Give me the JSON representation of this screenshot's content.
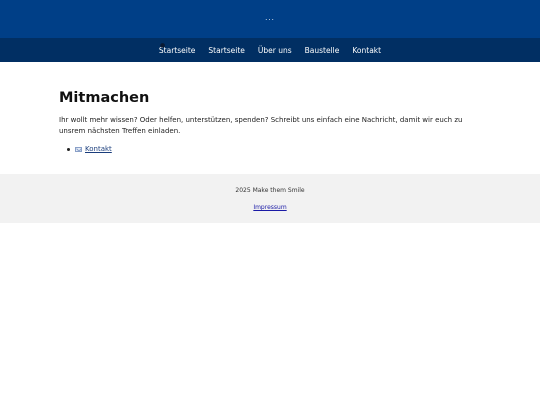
{
  "header": {
    "logo_text": "..."
  },
  "nav": {
    "items": [
      "Startseite",
      "Startseite",
      "Über uns",
      "Baustelle",
      "Kontakt"
    ]
  },
  "main": {
    "title": "Mitmachen",
    "intro": "Ihr wollt mehr wissen? Oder helfen, unterstützen, spenden? Schreibt uns einfach eine Nachricht, damit wir euch zu unsrem nächsten Treffen einladen.",
    "links": [
      {
        "icon": "mail-icon",
        "label": "Kontakt"
      }
    ]
  },
  "footer": {
    "copyright": "2025 Make them Smile",
    "impressum": "Impressum"
  },
  "colors": {
    "header_bg": "#003f87",
    "nav_bg": "#012f63",
    "footer_bg": "#f2f2f2"
  }
}
